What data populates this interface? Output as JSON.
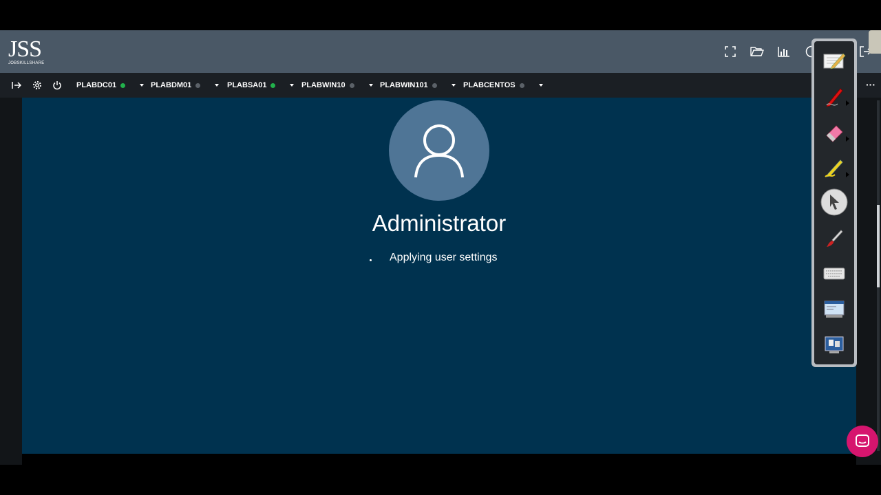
{
  "app": {
    "logo_main": "JSS",
    "logo_sub": "JOBSKILLSHARE"
  },
  "header_icons": [
    "fullscreen-icon",
    "folder-open-icon",
    "bar-chart-icon",
    "help-icon",
    "logout-icon"
  ],
  "vm_controls": [
    "enter-icon",
    "gear-icon",
    "power-icon"
  ],
  "vm_tabs": [
    {
      "name": "PLABDC01",
      "status": "online",
      "color": "#22b14c"
    },
    {
      "name": "PLABDM01",
      "status": "offline",
      "color": "#5b6168"
    },
    {
      "name": "PLABSA01",
      "status": "online",
      "color": "#22b14c"
    },
    {
      "name": "PLABWIN10",
      "status": "offline",
      "color": "#5b6168"
    },
    {
      "name": "PLABWIN101",
      "status": "offline",
      "color": "#5b6168"
    },
    {
      "name": "PLABCENTOS",
      "status": "offline",
      "color": "#5b6168"
    }
  ],
  "more_label": "···",
  "login_screen": {
    "username": "Administrator",
    "status": "Applying user settings",
    "background": "#00324f",
    "avatar_color": "#4f7596"
  },
  "annotation_tools": [
    "notepad-icon",
    "pen-icon",
    "eraser-icon",
    "highlighter-icon",
    "pointer-icon",
    "brush-icon",
    "keyboard-icon",
    "screen-capture-icon",
    "screen-share-icon"
  ],
  "chat_button": {
    "icon": "chat-icon",
    "color": "#d6156e"
  }
}
